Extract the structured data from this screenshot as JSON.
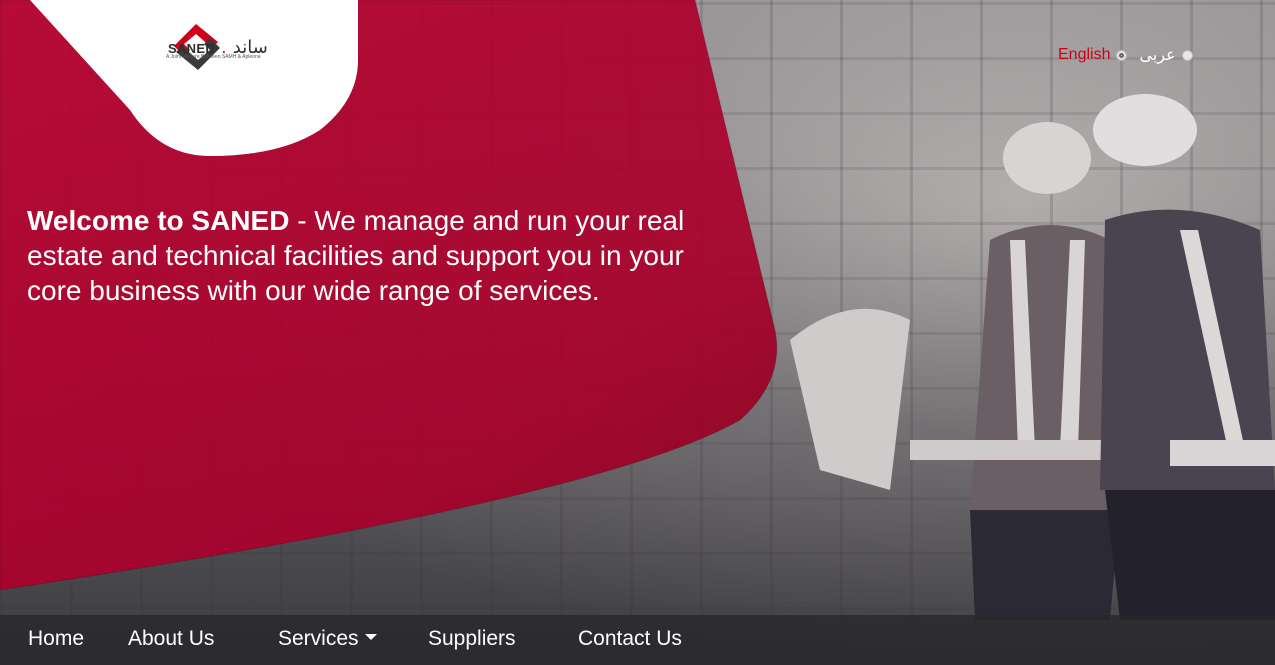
{
  "colors": {
    "brand_red": "#b0042c",
    "accent_red": "#d0021b",
    "nav_bg": "#2a282c",
    "text_light": "#ffffff"
  },
  "logo": {
    "brand": "SANED",
    "arabic": "ساند",
    "tagline": "A Joint Venture Between SAMH & Apleona",
    "icon": "saned-logo-icon"
  },
  "language": {
    "english_label": "English",
    "arabic_label": "عربى",
    "selected": "English"
  },
  "hero": {
    "headline_strong": "Welcome to SANED",
    "headline_rest": " - We manage and run your real estate and technical facilities and support you in your core business with our wide range of services."
  },
  "nav": {
    "items": [
      {
        "label": "Home"
      },
      {
        "label": "About Us"
      },
      {
        "label": "Services",
        "has_dropdown": true
      },
      {
        "label": "Suppliers"
      },
      {
        "label": "Contact Us"
      }
    ]
  }
}
